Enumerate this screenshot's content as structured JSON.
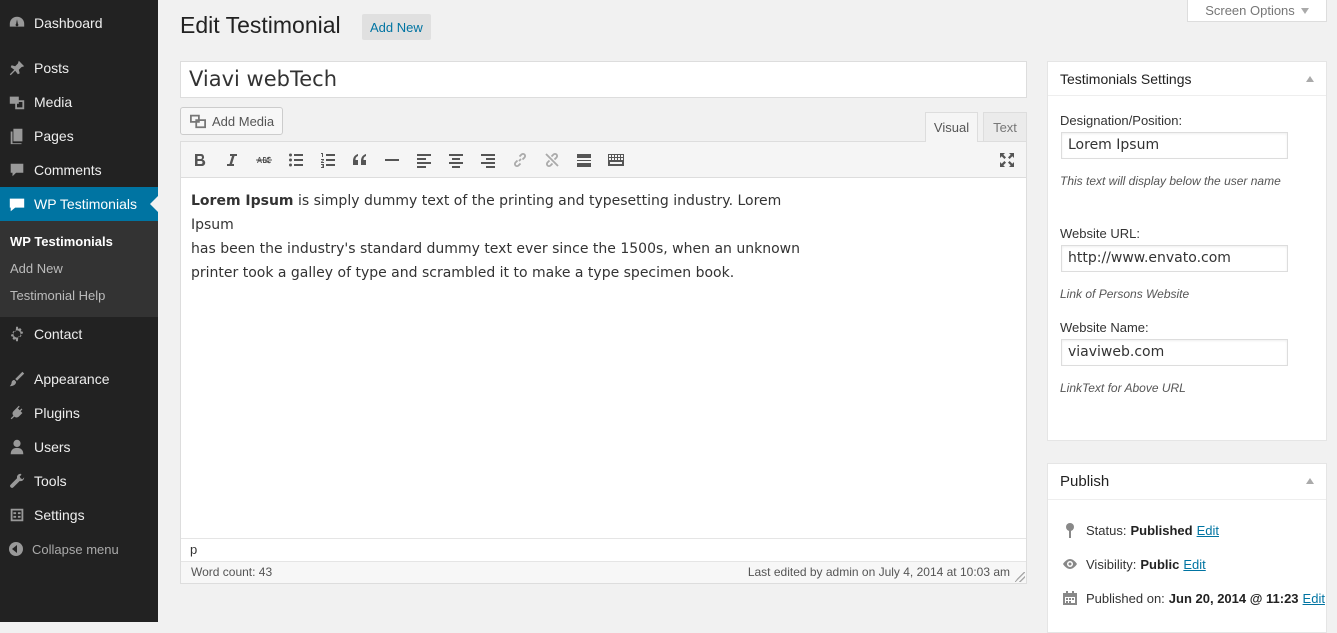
{
  "sidebar": {
    "items": [
      {
        "label": "Dashboard",
        "icon": "dashboard-icon"
      },
      {
        "label": "Posts",
        "icon": "pin-icon"
      },
      {
        "label": "Media",
        "icon": "media-icon"
      },
      {
        "label": "Pages",
        "icon": "pages-icon"
      },
      {
        "label": "Comments",
        "icon": "comments-icon"
      },
      {
        "label": "WP Testimonials",
        "icon": "testimonials-icon"
      },
      {
        "label": "Contact",
        "icon": "gear-icon"
      },
      {
        "label": "Appearance",
        "icon": "brush-icon"
      },
      {
        "label": "Plugins",
        "icon": "plug-icon"
      },
      {
        "label": "Users",
        "icon": "user-icon"
      },
      {
        "label": "Tools",
        "icon": "wrench-icon"
      },
      {
        "label": "Settings",
        "icon": "settings-icon"
      }
    ],
    "submenu": [
      "WP Testimonials",
      "Add New",
      "Testimonial Help"
    ],
    "collapse_label": "Collapse menu",
    "active_color": "#0074a2"
  },
  "header": {
    "title": "Edit Testimonial",
    "add_new_label": "Add New",
    "screen_options_label": "Screen Options"
  },
  "post_title": "Viavi webTech",
  "editor": {
    "add_media_label": "Add Media",
    "tab_visual": "Visual",
    "tab_text": "Text",
    "active_tab": "Visual",
    "toolbar_icons": [
      "bold-icon",
      "italic-icon",
      "strikethrough-icon",
      "bulleted-list-icon",
      "numbered-list-icon",
      "blockquote-icon",
      "horizontal-line-icon",
      "align-left-icon",
      "align-center-icon",
      "align-right-icon",
      "link-icon",
      "unlink-icon",
      "read-more-icon",
      "toolbar-toggle-icon",
      "fullscreen-icon"
    ],
    "content_bold": "Lorem Ipsum",
    "content_line1_rest": " is simply dummy text of the printing and typesetting industry. Lorem Ipsum",
    "content_line2": "has been the industry's standard dummy text ever since the 1500s, when an unknown",
    "content_line3": "printer took a galley of type and scrambled it to make a type specimen book.",
    "path": "p",
    "word_count": "Word count: 43",
    "last_edited": "Last edited by admin on July 4, 2014 at 10:03 am"
  },
  "settings_box": {
    "title": "Testimonials Settings",
    "designation_label": "Designation/Position:",
    "designation_value": "Lorem Ipsum",
    "designation_hint": "This text will display below the user name",
    "website_url_label": "Website URL:",
    "website_url_value": "http://www.envato.com",
    "website_url_hint": "Link of Persons Website",
    "website_name_label": "Website Name:",
    "website_name_value": "viaviweb.com",
    "website_name_hint": "LinkText for Above URL"
  },
  "publish_box": {
    "title": "Publish",
    "status_label": "Status:",
    "status_value": "Published",
    "visibility_label": "Visibility:",
    "visibility_value": "Public",
    "published_label": "Published on:",
    "published_value": "Jun 20, 2014 @ 11:23",
    "edit_label": "Edit"
  }
}
